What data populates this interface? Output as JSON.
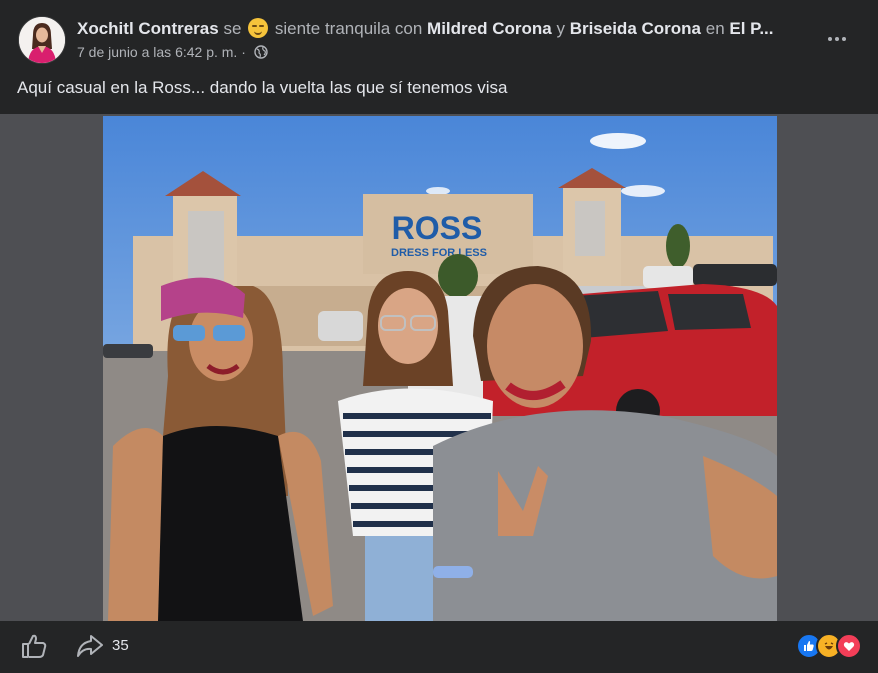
{
  "post": {
    "author": "Xochitl Contreras",
    "feeling_prefix": "se",
    "feeling_text": "siente tranquila con",
    "tagged_1": "Mildred Corona",
    "connector": "y",
    "tagged_2": "Briseida Corona",
    "location_prefix": "en",
    "location": "El P...",
    "timestamp": "7 de junio a las 6:42 p. m. ·",
    "caption": "Aquí casual en la Ross... dando la vuelta las que sí tenemos visa"
  },
  "photo": {
    "store_sign": "ROSS",
    "store_tagline": "DRESS FOR LESS"
  },
  "footer": {
    "share_count": "35"
  },
  "icons": {
    "privacy": "globe-icon",
    "menu": "more-icon",
    "like": "like-icon",
    "share": "share-icon",
    "reactions": [
      "like-reaction-icon",
      "haha-reaction-icon",
      "love-reaction-icon"
    ]
  },
  "colors": {
    "background": "#242526",
    "media_background": "#4e4f53",
    "text": "#e4e6eb",
    "secondary_text": "#b0b3b8",
    "like_blue": "#1877f2",
    "love_red": "#f33e58",
    "haha_yellow": "#f7b125"
  }
}
